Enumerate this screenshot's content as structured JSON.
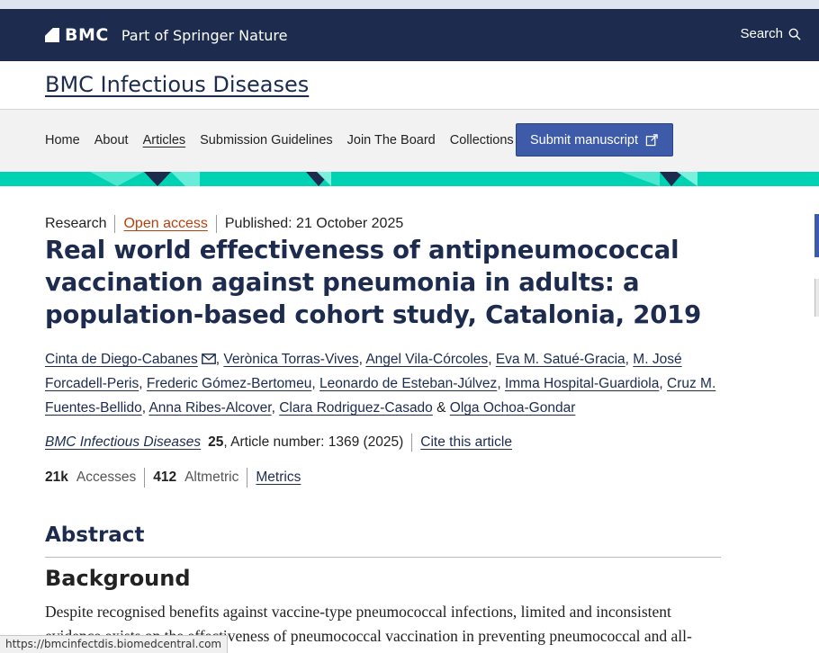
{
  "brand": {
    "logo_text": "BMC",
    "tagline": "Part of Springer Nature",
    "search_label": "Search"
  },
  "journal": {
    "title": "BMC Infectious Diseases"
  },
  "nav": {
    "items": [
      "Home",
      "About",
      "Articles",
      "Submission Guidelines",
      "Join The Board",
      "Collections"
    ],
    "active": "Articles",
    "submit_label": "Submit manuscript"
  },
  "colors": {
    "brand_dark": "#1c2b4e",
    "accent_teal": "#00d2b4",
    "submit_blue": "#3d5ba9",
    "open_access": "#b7410e"
  },
  "article": {
    "type": "Research",
    "open_access": "Open access",
    "published": "Published: 21 October 2025",
    "title": "Real world effectiveness of antipneumococcal vaccination against pneumonia in adults: a population-based cohort study, Catalonia, 2019",
    "authors": [
      "Cinta de Diego-Cabanes",
      "Verònica Torras-Vives",
      "Angel Vila-Córcoles",
      "Eva M. Satué-Gracia",
      "M. José Forcadell-Peris",
      "Frederic Gómez-Bertomeu",
      "Leonardo de Esteban-Júlvez",
      "Imma Hospital-Guardiola",
      "Cruz M. Fuentes-Bellido",
      "Anna Ribes-Alcover",
      "Clara Rodriguez-Casado",
      "Olga Ochoa-Gondar"
    ],
    "author_last_joiner": "&",
    "citation": {
      "journal": "BMC Infectious Diseases",
      "volume": "25",
      "article_number": ", Article number: 1369 (2025)",
      "cite_label": "Cite this article"
    },
    "metrics": {
      "accesses_value": "21k",
      "accesses_label": "Accesses",
      "altmetric_value": "412",
      "altmetric_label": "Altmetric",
      "metrics_link": "Metrics"
    }
  },
  "abstract": {
    "heading": "Abstract",
    "background_heading": "Background",
    "text": "Despite recognised benefits against vaccine-type pneumococcal infections, limited and inconsistent evidence exists on the effectiveness of pneumococcal vaccination in preventing pneumococcal and all-"
  },
  "status_bar": {
    "url": "https://bmcinfectdis.biomedcentral.com"
  }
}
